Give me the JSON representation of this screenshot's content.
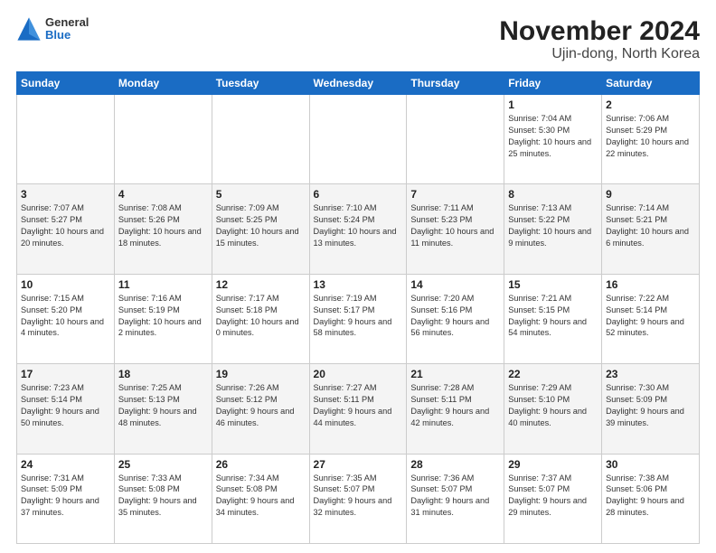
{
  "logo": {
    "line1": "General",
    "line2": "Blue"
  },
  "title": "November 2024",
  "subtitle": "Ujin-dong, North Korea",
  "days_of_week": [
    "Sunday",
    "Monday",
    "Tuesday",
    "Wednesday",
    "Thursday",
    "Friday",
    "Saturday"
  ],
  "weeks": [
    [
      {
        "day": "",
        "info": ""
      },
      {
        "day": "",
        "info": ""
      },
      {
        "day": "",
        "info": ""
      },
      {
        "day": "",
        "info": ""
      },
      {
        "day": "",
        "info": ""
      },
      {
        "day": "1",
        "info": "Sunrise: 7:04 AM\nSunset: 5:30 PM\nDaylight: 10 hours and 25 minutes."
      },
      {
        "day": "2",
        "info": "Sunrise: 7:06 AM\nSunset: 5:29 PM\nDaylight: 10 hours and 22 minutes."
      }
    ],
    [
      {
        "day": "3",
        "info": "Sunrise: 7:07 AM\nSunset: 5:27 PM\nDaylight: 10 hours and 20 minutes."
      },
      {
        "day": "4",
        "info": "Sunrise: 7:08 AM\nSunset: 5:26 PM\nDaylight: 10 hours and 18 minutes."
      },
      {
        "day": "5",
        "info": "Sunrise: 7:09 AM\nSunset: 5:25 PM\nDaylight: 10 hours and 15 minutes."
      },
      {
        "day": "6",
        "info": "Sunrise: 7:10 AM\nSunset: 5:24 PM\nDaylight: 10 hours and 13 minutes."
      },
      {
        "day": "7",
        "info": "Sunrise: 7:11 AM\nSunset: 5:23 PM\nDaylight: 10 hours and 11 minutes."
      },
      {
        "day": "8",
        "info": "Sunrise: 7:13 AM\nSunset: 5:22 PM\nDaylight: 10 hours and 9 minutes."
      },
      {
        "day": "9",
        "info": "Sunrise: 7:14 AM\nSunset: 5:21 PM\nDaylight: 10 hours and 6 minutes."
      }
    ],
    [
      {
        "day": "10",
        "info": "Sunrise: 7:15 AM\nSunset: 5:20 PM\nDaylight: 10 hours and 4 minutes."
      },
      {
        "day": "11",
        "info": "Sunrise: 7:16 AM\nSunset: 5:19 PM\nDaylight: 10 hours and 2 minutes."
      },
      {
        "day": "12",
        "info": "Sunrise: 7:17 AM\nSunset: 5:18 PM\nDaylight: 10 hours and 0 minutes."
      },
      {
        "day": "13",
        "info": "Sunrise: 7:19 AM\nSunset: 5:17 PM\nDaylight: 9 hours and 58 minutes."
      },
      {
        "day": "14",
        "info": "Sunrise: 7:20 AM\nSunset: 5:16 PM\nDaylight: 9 hours and 56 minutes."
      },
      {
        "day": "15",
        "info": "Sunrise: 7:21 AM\nSunset: 5:15 PM\nDaylight: 9 hours and 54 minutes."
      },
      {
        "day": "16",
        "info": "Sunrise: 7:22 AM\nSunset: 5:14 PM\nDaylight: 9 hours and 52 minutes."
      }
    ],
    [
      {
        "day": "17",
        "info": "Sunrise: 7:23 AM\nSunset: 5:14 PM\nDaylight: 9 hours and 50 minutes."
      },
      {
        "day": "18",
        "info": "Sunrise: 7:25 AM\nSunset: 5:13 PM\nDaylight: 9 hours and 48 minutes."
      },
      {
        "day": "19",
        "info": "Sunrise: 7:26 AM\nSunset: 5:12 PM\nDaylight: 9 hours and 46 minutes."
      },
      {
        "day": "20",
        "info": "Sunrise: 7:27 AM\nSunset: 5:11 PM\nDaylight: 9 hours and 44 minutes."
      },
      {
        "day": "21",
        "info": "Sunrise: 7:28 AM\nSunset: 5:11 PM\nDaylight: 9 hours and 42 minutes."
      },
      {
        "day": "22",
        "info": "Sunrise: 7:29 AM\nSunset: 5:10 PM\nDaylight: 9 hours and 40 minutes."
      },
      {
        "day": "23",
        "info": "Sunrise: 7:30 AM\nSunset: 5:09 PM\nDaylight: 9 hours and 39 minutes."
      }
    ],
    [
      {
        "day": "24",
        "info": "Sunrise: 7:31 AM\nSunset: 5:09 PM\nDaylight: 9 hours and 37 minutes."
      },
      {
        "day": "25",
        "info": "Sunrise: 7:33 AM\nSunset: 5:08 PM\nDaylight: 9 hours and 35 minutes."
      },
      {
        "day": "26",
        "info": "Sunrise: 7:34 AM\nSunset: 5:08 PM\nDaylight: 9 hours and 34 minutes."
      },
      {
        "day": "27",
        "info": "Sunrise: 7:35 AM\nSunset: 5:07 PM\nDaylight: 9 hours and 32 minutes."
      },
      {
        "day": "28",
        "info": "Sunrise: 7:36 AM\nSunset: 5:07 PM\nDaylight: 9 hours and 31 minutes."
      },
      {
        "day": "29",
        "info": "Sunrise: 7:37 AM\nSunset: 5:07 PM\nDaylight: 9 hours and 29 minutes."
      },
      {
        "day": "30",
        "info": "Sunrise: 7:38 AM\nSunset: 5:06 PM\nDaylight: 9 hours and 28 minutes."
      }
    ]
  ]
}
